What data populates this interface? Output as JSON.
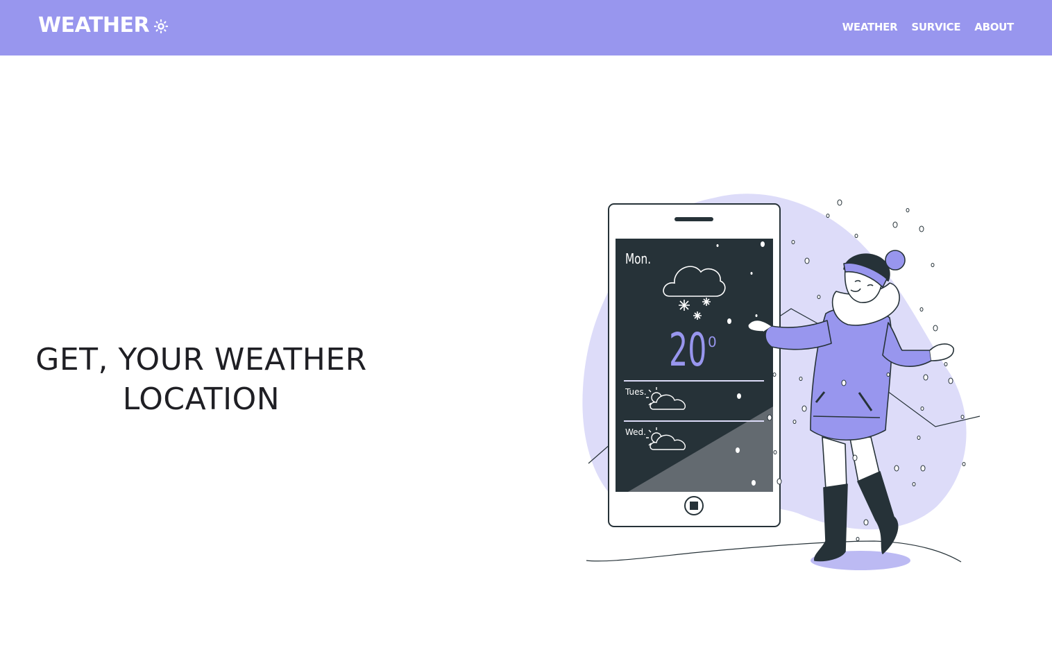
{
  "navbar": {
    "brand": "WEATHER",
    "brand_icon": "sun-icon",
    "links": [
      "WEATHER",
      "SURVICE",
      "ABOUT"
    ]
  },
  "hero": {
    "line1": "GET, YOUR WEATHER",
    "line2": "LOCATION"
  },
  "phone": {
    "day": "Mon.",
    "temperature": "20",
    "degree": "0",
    "forecast": [
      {
        "day": "Tues.",
        "icon": "partly-cloudy-icon"
      },
      {
        "day": "Wed.",
        "icon": "partly-cloudy-icon"
      }
    ],
    "main_icon": "snow-cloud-icon"
  },
  "colors": {
    "accent": "#9896ee",
    "accent_light": "#dddcf9",
    "screen": "#263238",
    "text": "#1f1f24"
  }
}
